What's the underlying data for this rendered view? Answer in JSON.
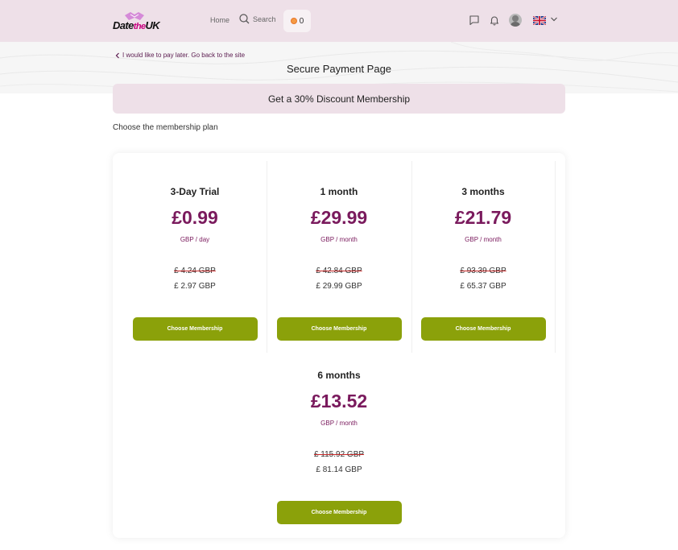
{
  "header": {
    "logo_date": "Date",
    "logo_the": "the",
    "logo_uk": "UK",
    "nav_home": "Home",
    "nav_search": "Search",
    "coins": "0"
  },
  "page": {
    "back_link": "I would like to pay later. Go back to the site",
    "title": "Secure Payment Page",
    "discount_banner": "Get a 30% Discount Membership",
    "choose_plan": "Choose the membership plan"
  },
  "plans": [
    {
      "name": "3-Day Trial",
      "price": "£0.99",
      "unit": "GBP / day",
      "old_total": "£ 4.24 GBP",
      "new_total": "£ 2.97 GBP",
      "button": "Choose Membership"
    },
    {
      "name": "1 month",
      "price": "£29.99",
      "unit": "GBP / month",
      "old_total": "£ 42.84 GBP",
      "new_total": "£ 29.99 GBP",
      "button": "Choose Membership"
    },
    {
      "name": "3 months",
      "price": "£21.79",
      "unit": "GBP / month",
      "old_total": "£ 93.39 GBP",
      "new_total": "£ 65.37 GBP",
      "button": "Choose Membership"
    },
    {
      "name": "6 months",
      "price": "£13.52",
      "unit": "GBP / month",
      "old_total": "£ 115.92 GBP",
      "new_total": "£ 81.14 GBP",
      "button": "Choose Membership"
    }
  ],
  "colors": {
    "header_bg": "#eee0e8",
    "price": "#7a1a5d",
    "button": "#8ba10a",
    "coin": "#f59a43"
  }
}
